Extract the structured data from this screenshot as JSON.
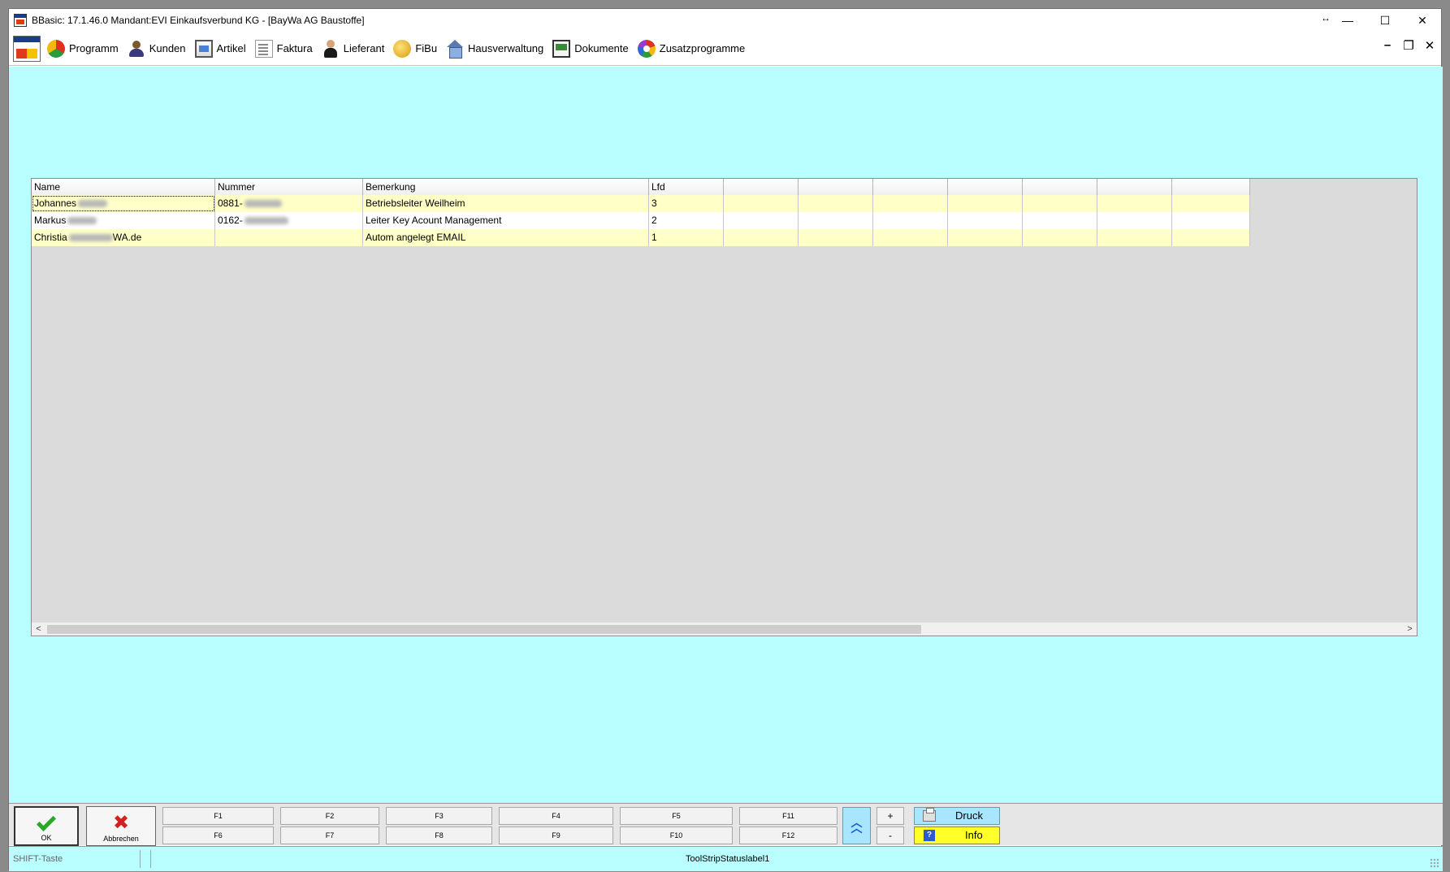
{
  "window": {
    "title": "BBasic: 17.1.46.0 Mandant:EVI Einkaufsverbund KG  - [BayWa AG Baustoffe]",
    "resize_glyph": "↔",
    "min_glyph": "—",
    "max_glyph": "☐",
    "close_glyph": "✕"
  },
  "menu": {
    "items": [
      {
        "label": "Programm",
        "icon": "programm-icon"
      },
      {
        "label": "Kunden",
        "icon": "kunden-icon"
      },
      {
        "label": "Artikel",
        "icon": "artikel-icon"
      },
      {
        "label": "Faktura",
        "icon": "faktura-icon"
      },
      {
        "label": "Lieferant",
        "icon": "lieferant-icon"
      },
      {
        "label": "FiBu",
        "icon": "fibu-icon"
      },
      {
        "label": "Hausverwaltung",
        "icon": "hausverwaltung-icon"
      },
      {
        "label": "Dokumente",
        "icon": "dokumente-icon"
      },
      {
        "label": "Zusatzprogramme",
        "icon": "zusatzprogramme-icon"
      }
    ],
    "mdi_min": "–",
    "mdi_restore": "❐",
    "mdi_close": "✕"
  },
  "grid": {
    "columns": [
      "Name",
      "Nummer",
      "Bemerkung",
      "Lfd",
      "",
      "",
      "",
      "",
      "",
      "",
      ""
    ],
    "rows": [
      {
        "name": "Johannes",
        "nummer": "0881-",
        "bemerkung": "Betriebsleiter Weilheim",
        "lfd": "3"
      },
      {
        "name": "Markus",
        "nummer": "0162-",
        "bemerkung": "Leiter Key Acount Management",
        "lfd": "2"
      },
      {
        "name": "Christia",
        "name_suffix": "WA.de",
        "nummer": "",
        "bemerkung": "Autom angelegt EMAIL",
        "lfd": "1"
      }
    ],
    "scroll_left": "<",
    "scroll_right": ">"
  },
  "buttons": {
    "ok": "OK",
    "abbrechen": "Abbrechen",
    "f_top": [
      "F1",
      "F2",
      "F3",
      "F4",
      "F5",
      "F11"
    ],
    "f_bottom": [
      "F6",
      "F7",
      "F8",
      "F9",
      "F10",
      "F12"
    ],
    "plus": "+",
    "minus": "-",
    "druck": "Druck",
    "info": "Info"
  },
  "status": {
    "shift": "SHIFT-Taste",
    "label": "ToolStripStatuslabel1"
  },
  "colors": {
    "client_bg": "#b9ffff",
    "row_highlight": "#ffffc8",
    "druck_bg": "#a8e6ff",
    "info_bg": "#ffff2a"
  }
}
